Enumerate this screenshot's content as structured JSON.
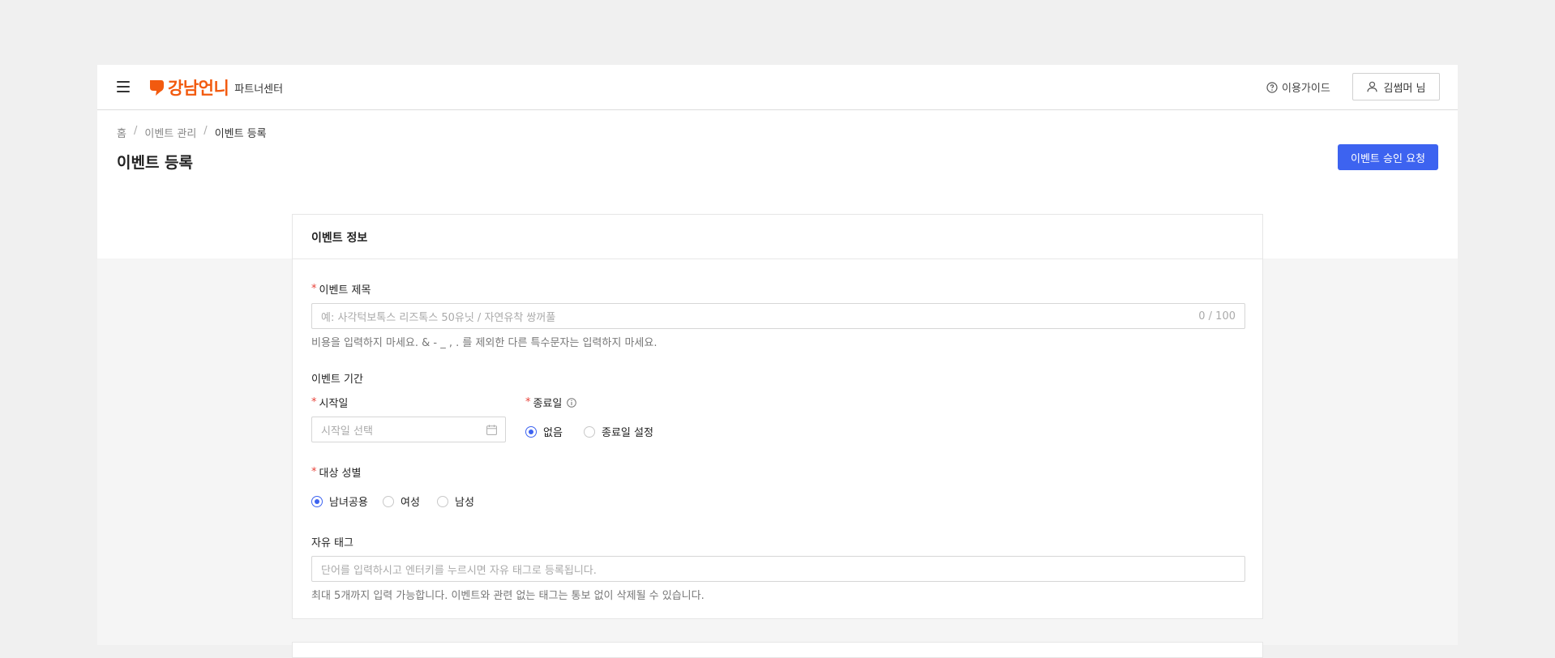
{
  "header": {
    "brand": "강남언니",
    "brand_sub": "파트너센터",
    "guide_label": "이용가이드",
    "user_label": "김썸머 님"
  },
  "breadcrumb": [
    "홈",
    "이벤트 관리",
    "이벤트 등록"
  ],
  "page": {
    "title": "이벤트 등록",
    "submit_label": "이벤트 승인 요청"
  },
  "card": {
    "title": "이벤트 정보",
    "event_title": {
      "label": "이벤트 제목",
      "placeholder": "예: 사각턱보톡스 리즈톡스 50유닛 / 자연유착 쌍꺼풀",
      "counter": "0 / 100",
      "help": "비용을 입력하지 마세요. & - _ , . 를 제외한 다른 특수문자는 입력하지 마세요."
    },
    "period": {
      "label": "이벤트 기간",
      "start_label": "시작일",
      "start_placeholder": "시작일 선택",
      "end_label": "종료일",
      "end_options": [
        {
          "label": "없음",
          "selected": true
        },
        {
          "label": "종료일 설정",
          "selected": false
        }
      ]
    },
    "gender": {
      "label": "대상 성별",
      "options": [
        {
          "label": "남녀공용",
          "selected": true
        },
        {
          "label": "여성",
          "selected": false
        },
        {
          "label": "남성",
          "selected": false
        }
      ]
    },
    "tags": {
      "label": "자유 태그",
      "placeholder": "단어를 입력하시고 엔터키를 누르시면 자유 태그로 등록됩니다.",
      "help": "최대 5개까지 입력 가능합니다. 이벤트와 관련 없는 태그는 통보 없이 삭제될 수 있습니다."
    }
  },
  "colors": {
    "brand": "#f25a0f",
    "accent": "#3d63f0",
    "required": "#e8433a"
  }
}
